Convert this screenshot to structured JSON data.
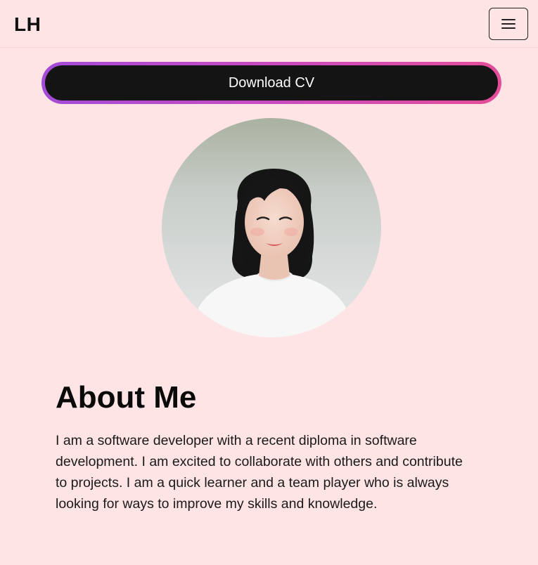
{
  "header": {
    "logo": "LH",
    "menu_icon": "hamburger-menu-icon"
  },
  "hero": {
    "download_label": "Download CV",
    "avatar_icon": "profile-photo"
  },
  "about": {
    "title": "About Me",
    "body": "I am a software developer with a recent diploma in software development. I am excited to collaborate with others and contribute to projects. I am a quick learner and a team player who is always looking for ways to improve my skills and knowledge."
  },
  "colors": {
    "background": "#ffe4e6",
    "button_bg": "#141414",
    "gradient_start": "#a44bd8",
    "gradient_end": "#e54d9a"
  }
}
